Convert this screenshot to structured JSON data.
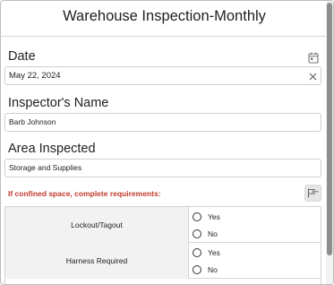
{
  "form": {
    "title": "Warehouse Inspection-Monthly"
  },
  "fields": {
    "date": {
      "label": "Date",
      "value": "May 22, 2024",
      "icon": "calendar-icon",
      "clear_icon": "clear-icon"
    },
    "inspector": {
      "label": "Inspector's Name",
      "value": "Barb Johnson"
    },
    "area": {
      "label": "Area Inspected",
      "value": "Storage and Supplies"
    }
  },
  "requirements": {
    "note": "If confined space, complete requirements:",
    "note_color": "#c0392b",
    "pin_icon": "pin-icon",
    "rows": [
      {
        "name": "Lockout/Tagout",
        "options": [
          "Yes",
          "No"
        ]
      },
      {
        "name": "Harness Required",
        "options": [
          "Yes",
          "No"
        ]
      }
    ]
  }
}
